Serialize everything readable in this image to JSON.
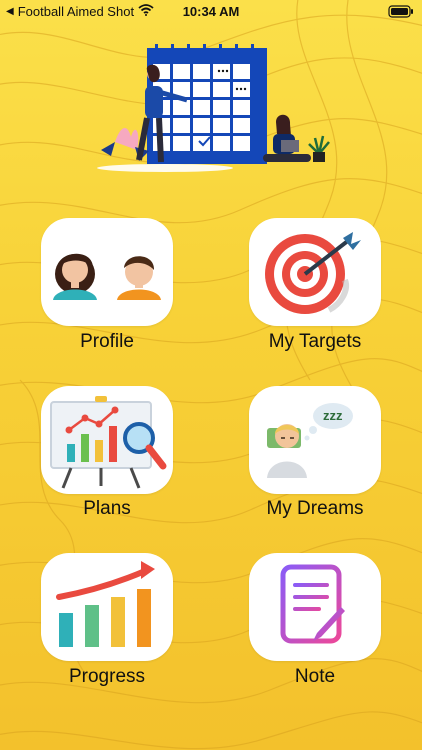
{
  "status_bar": {
    "back_app": "Football Aimed Shot",
    "time": "10:34 AM"
  },
  "menu": [
    {
      "label": "Profile",
      "icon": "two-avatars-icon"
    },
    {
      "label": "My Targets",
      "icon": "target-dart-icon"
    },
    {
      "label": "Plans",
      "icon": "presentation-board-icon"
    },
    {
      "label": "My Dreams",
      "icon": "sleeping-person-icon"
    },
    {
      "label": "Progress",
      "icon": "bar-growth-icon"
    },
    {
      "label": "Note",
      "icon": "note-pen-icon"
    }
  ],
  "colors": {
    "background": "#f7cf2e",
    "tile": "#ffffff",
    "calendar_blue": "#1447b8"
  }
}
